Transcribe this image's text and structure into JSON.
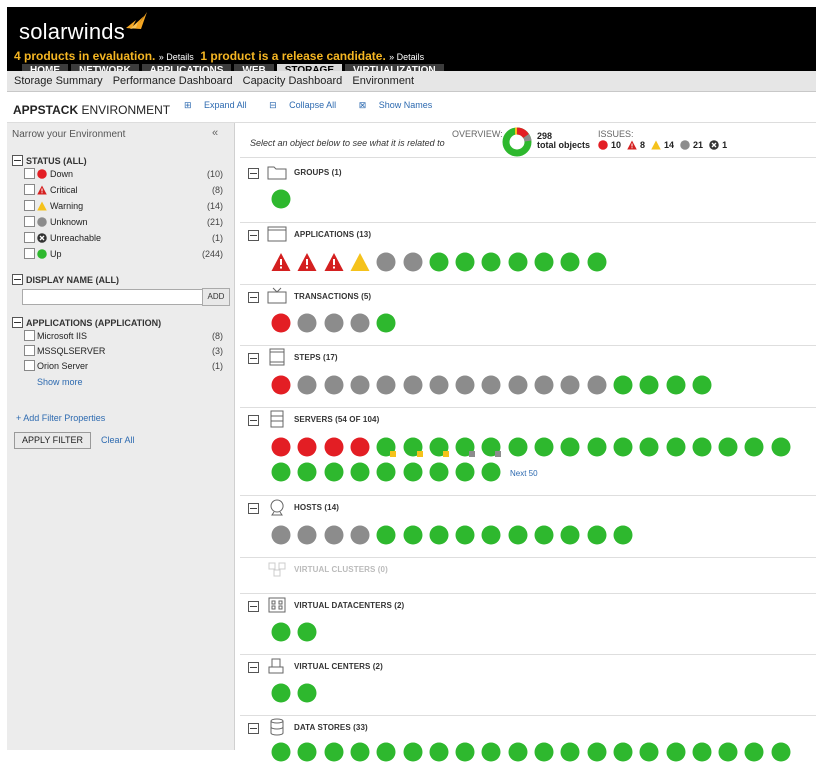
{
  "header": {
    "brand": "solarwinds",
    "eval_msg_1": "4 products in evaluation.",
    "details_1": "» Details",
    "eval_msg_2": "1 product is a release candidate.",
    "details_2": "» Details",
    "tabs": [
      "HOME",
      "NETWORK",
      "APPLICATIONS",
      "WEB",
      "STORAGE",
      "VIRTUALIZATION"
    ],
    "active_tab": "STORAGE"
  },
  "subnav": {
    "items": [
      "Storage Summary",
      "Performance Dashboard",
      "Capacity Dashboard",
      "Environment"
    ]
  },
  "appbar": {
    "title_bold": "APPSTACK",
    "title_rest": " ENVIRONMENT",
    "expand_all": "Expand All",
    "collapse_all": "Collapse All",
    "show_names": "Show Names"
  },
  "filters": {
    "heading": "Narrow your Environment",
    "collapse_glyph": "«",
    "status_title": "STATUS (ALL)",
    "status_items": [
      {
        "label": "Down",
        "count": "(10)",
        "icon": "down"
      },
      {
        "label": "Critical",
        "count": "(8)",
        "icon": "critical"
      },
      {
        "label": "Warning",
        "count": "(14)",
        "icon": "warning"
      },
      {
        "label": "Unknown",
        "count": "(21)",
        "icon": "unknown"
      },
      {
        "label": "Unreachable",
        "count": "(1)",
        "icon": "unreachable"
      },
      {
        "label": "Up",
        "count": "(244)",
        "icon": "up"
      }
    ],
    "display_name_title": "DISPLAY NAME (ALL)",
    "add_label": "ADD",
    "applications_title": "APPLICATIONS (APPLICATION)",
    "application_items": [
      {
        "label": "Microsoft IIS",
        "count": "(8)"
      },
      {
        "label": "MSSQLSERVER",
        "count": "(3)"
      },
      {
        "label": "Orion Server",
        "count": "(1)"
      }
    ],
    "show_more": "Show more",
    "add_filter": "+ Add Filter Properties",
    "apply_filter": "APPLY FILTER",
    "clear_all": "Clear All"
  },
  "overview": {
    "hint": "Select an object below to see what it is related to",
    "overview_label": "OVERVIEW:",
    "total": "298",
    "total_label": "total objects",
    "issues_label": "ISSUES:",
    "issues": [
      {
        "icon": "down",
        "count": "10"
      },
      {
        "icon": "critical",
        "count": "8"
      },
      {
        "icon": "warning",
        "count": "14"
      },
      {
        "icon": "unknown",
        "count": "21"
      },
      {
        "icon": "unreachable",
        "count": "1"
      }
    ]
  },
  "colors": {
    "up": "#2eb82e",
    "down": "#e31e24",
    "critical": "#d42020",
    "warning": "#f5c21b",
    "unknown": "#8c8c8c",
    "accent": "#f5a623"
  },
  "groups": [
    {
      "name": "groups",
      "title": "GROUPS (1)",
      "icon": "folder-icon",
      "collapsible": true,
      "rows": [
        [
          "up"
        ]
      ]
    },
    {
      "name": "applications",
      "title": "APPLICATIONS (13)",
      "icon": "window-icon",
      "collapsible": true,
      "rows": [
        [
          "critical",
          "critical",
          "critical",
          "warning",
          "unknown",
          "unknown",
          "up",
          "up",
          "up",
          "up",
          "up",
          "up",
          "up"
        ]
      ]
    },
    {
      "name": "transactions",
      "title": "TRANSACTIONS (5)",
      "icon": "tv-icon",
      "collapsible": true,
      "rows": [
        [
          "down",
          "unknown",
          "unknown",
          "unknown",
          "up"
        ]
      ]
    },
    {
      "name": "steps",
      "title": "STEPS (17)",
      "icon": "film-icon",
      "collapsible": true,
      "rows": [
        [
          "down",
          "unknown",
          "unknown",
          "unknown",
          "unknown",
          "unknown",
          "unknown",
          "unknown",
          "unknown",
          "unknown",
          "unknown",
          "unknown",
          "unknown",
          "up",
          "up",
          "up",
          "up"
        ]
      ]
    },
    {
      "name": "servers",
      "title": "SERVERS (54 OF 104)",
      "icon": "server-icon",
      "collapsible": true,
      "rows": [
        [
          "down",
          "down",
          "down",
          "down",
          "up-warning",
          "up-warning",
          "up-warning",
          "up-unknown",
          "up-unknown",
          "up",
          "up",
          "up",
          "up",
          "up",
          "up",
          "up",
          "up",
          "up",
          "up",
          "up"
        ],
        [
          "up",
          "up",
          "up",
          "up",
          "up",
          "up",
          "up",
          "up",
          "up"
        ]
      ],
      "next": "Next 50"
    },
    {
      "name": "hosts",
      "title": "HOSTS (14)",
      "icon": "host-icon",
      "collapsible": true,
      "rows": [
        [
          "unknown",
          "unknown",
          "unknown",
          "unknown",
          "up",
          "up",
          "up",
          "up",
          "up",
          "up",
          "up",
          "up",
          "up",
          "up"
        ]
      ]
    },
    {
      "name": "virtual-clusters",
      "title": "VIRTUAL CLUSTERS (0)",
      "icon": "cluster-icon",
      "collapsible": false,
      "dim": true,
      "rows": []
    },
    {
      "name": "virtual-datacenters",
      "title": "VIRTUAL DATACENTERS (2)",
      "icon": "datacenter-icon",
      "collapsible": true,
      "rows": [
        [
          "up",
          "up"
        ]
      ]
    },
    {
      "name": "virtual-centers",
      "title": "VIRTUAL CENTERS (2)",
      "icon": "vcenter-icon",
      "collapsible": true,
      "rows": [
        [
          "up",
          "up"
        ]
      ]
    },
    {
      "name": "data-stores",
      "title": "DATA STORES (33)",
      "icon": "database-icon",
      "collapsible": true,
      "rows": [
        [
          "up",
          "up",
          "up",
          "up",
          "up",
          "up",
          "up",
          "up",
          "up",
          "up",
          "up",
          "up",
          "up",
          "up",
          "up",
          "up",
          "up",
          "up",
          "up",
          "up"
        ]
      ]
    }
  ]
}
